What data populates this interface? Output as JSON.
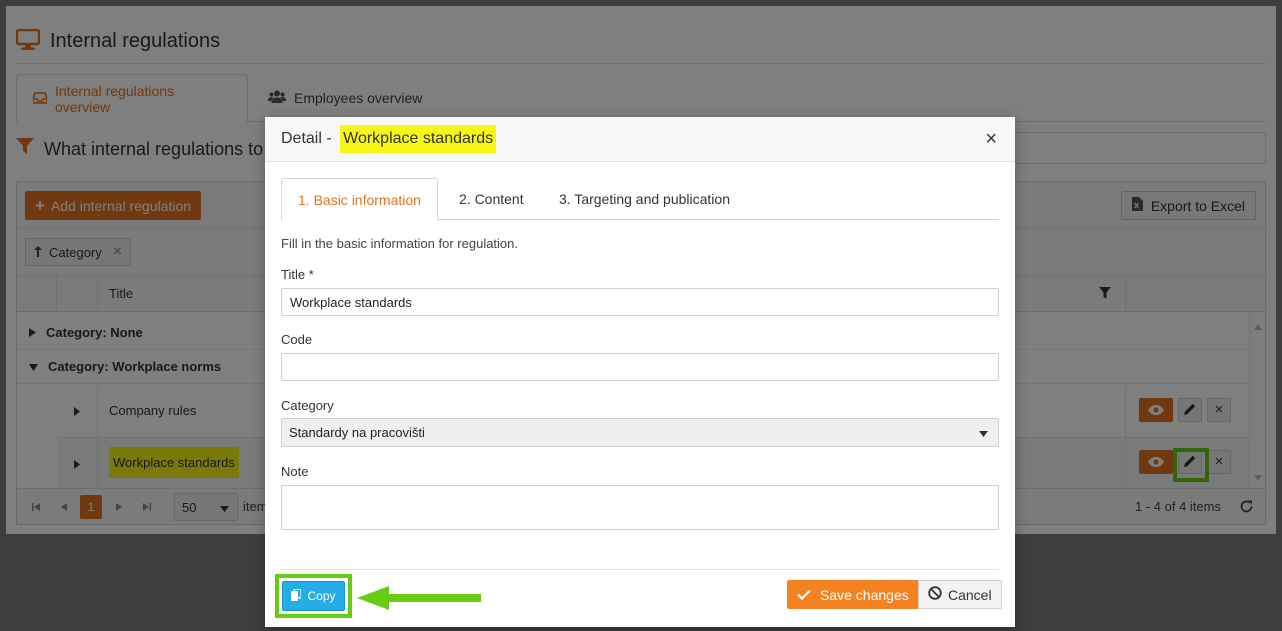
{
  "page": {
    "title": "Internal regulations",
    "tabs": [
      {
        "label": "Internal regulations overview",
        "active": true
      },
      {
        "label": "Employees overview",
        "active": false
      }
    ],
    "filter_heading": "What internal regulations to"
  },
  "grid": {
    "add_label": "Add internal regulation",
    "export_label": "Export to Excel",
    "group_chip": "Category",
    "column_title": "Title",
    "groups": [
      {
        "label": "Category: None",
        "expanded": false
      },
      {
        "label": "Category: Workplace norms",
        "expanded": true
      }
    ],
    "rows": [
      {
        "title": "Company rules"
      },
      {
        "title": "Workplace standards",
        "highlighted": true
      }
    ],
    "pager": {
      "current_page": "1",
      "page_size": "50",
      "items_label": "item",
      "info": "1 - 4 of 4 items"
    }
  },
  "modal": {
    "title_prefix": "Detail - ",
    "title_name": "Workplace standards",
    "close": "×",
    "tabs": [
      {
        "label": "1. Basic information",
        "active": true
      },
      {
        "label": "2. Content",
        "active": false
      },
      {
        "label": "3. Targeting and publication",
        "active": false
      }
    ],
    "intro": "Fill in the basic information for regulation.",
    "fields": {
      "title_label": "Title *",
      "title_value": "Workplace standards",
      "code_label": "Code",
      "code_value": "",
      "category_label": "Category",
      "category_value": "Standardy na pracovišti",
      "note_label": "Note",
      "note_value": ""
    },
    "buttons": {
      "copy": "Copy",
      "save": "Save changes",
      "cancel": "Cancel"
    }
  },
  "colors": {
    "accent": "#e0731f",
    "save": "#f58220",
    "copy": "#25aee5",
    "highlight": "#f5f516",
    "annotation": "#66cc14"
  }
}
